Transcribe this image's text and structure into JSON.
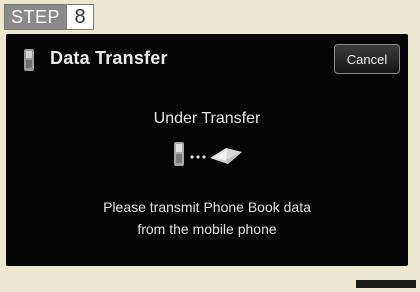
{
  "step": {
    "label": "STEP",
    "number": "8"
  },
  "screen": {
    "title": "Data Transfer",
    "cancel_label": "Cancel",
    "status_title": "Under Transfer",
    "message_line1": "Please transmit Phone Book data",
    "message_line2": "from the mobile phone"
  },
  "icons": {
    "header": "mobile-phone-icon",
    "transfer_source": "mobile-phone-icon",
    "transfer_target": "phone-book-icon"
  },
  "colors": {
    "screen_background": "#050505",
    "page_background": "#ece8d0",
    "step_badge": "#8a8a8a"
  }
}
